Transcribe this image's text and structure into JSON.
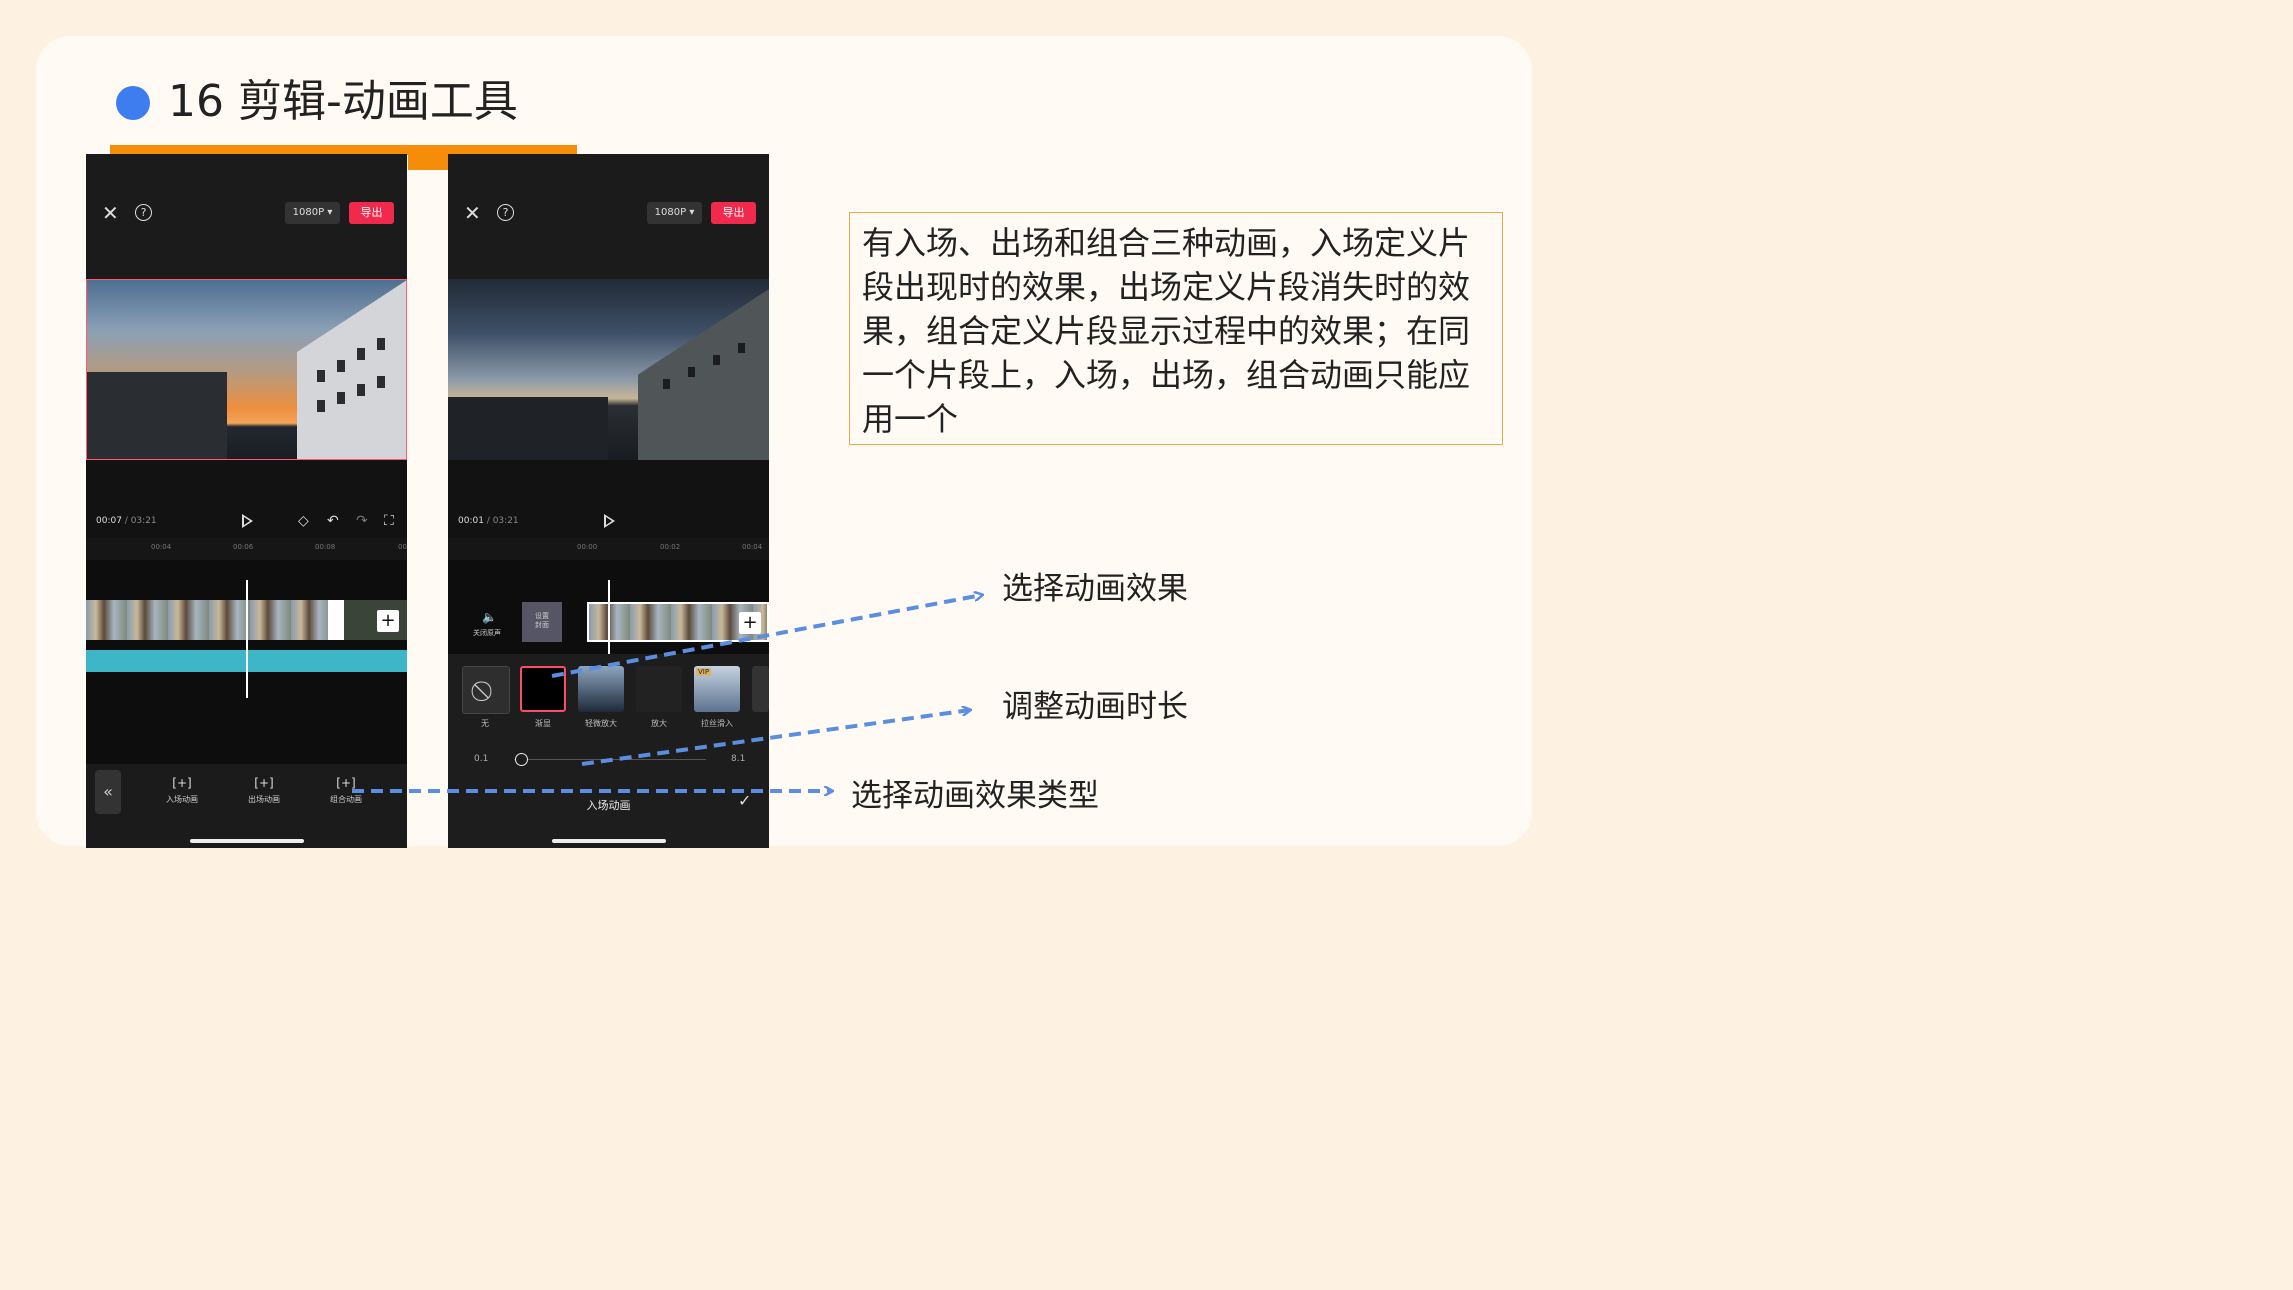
{
  "slide": {
    "title": "16 剪辑-动画工具",
    "description": "有入场、出场和组合三种动画，入场定义片段出现时的效果，出场定义片段消失时的效果，组合定义片段显示过程中的效果；在同一个片段上，入场，出场，组合动画只能应用一个"
  },
  "colors": {
    "accent": "#f58d0b",
    "bullet": "#3d7df0",
    "export": "#f0294d",
    "arrow": "#5b8ee0"
  },
  "phone1": {
    "resolution": "1080P ▾",
    "export": "导出",
    "time_current": "00:07",
    "time_sep": " / ",
    "time_total": "03:21",
    "ticks": [
      "00:04",
      "00:06",
      "00:08",
      "00"
    ],
    "tools": [
      "入场动画",
      "出场动画",
      "组合动画"
    ]
  },
  "phone2": {
    "resolution": "1080P ▾",
    "export": "导出",
    "time_current": "00:01",
    "time_sep": " / ",
    "time_total": "03:21",
    "ticks": [
      "00:00",
      "00:02",
      "00:04"
    ],
    "mute_label": "关闭原声",
    "cover_label": "设置\n封面",
    "effects": [
      "无",
      "渐显",
      "轻微放大",
      "放大",
      "拉丝滑入"
    ],
    "vip": "VIP",
    "slider_min": "0.1",
    "slider_max": "8.1",
    "panel_title": "入场动画"
  },
  "annotations": [
    "选择动画效果",
    "调整动画时长",
    "选择动画效果类型"
  ]
}
